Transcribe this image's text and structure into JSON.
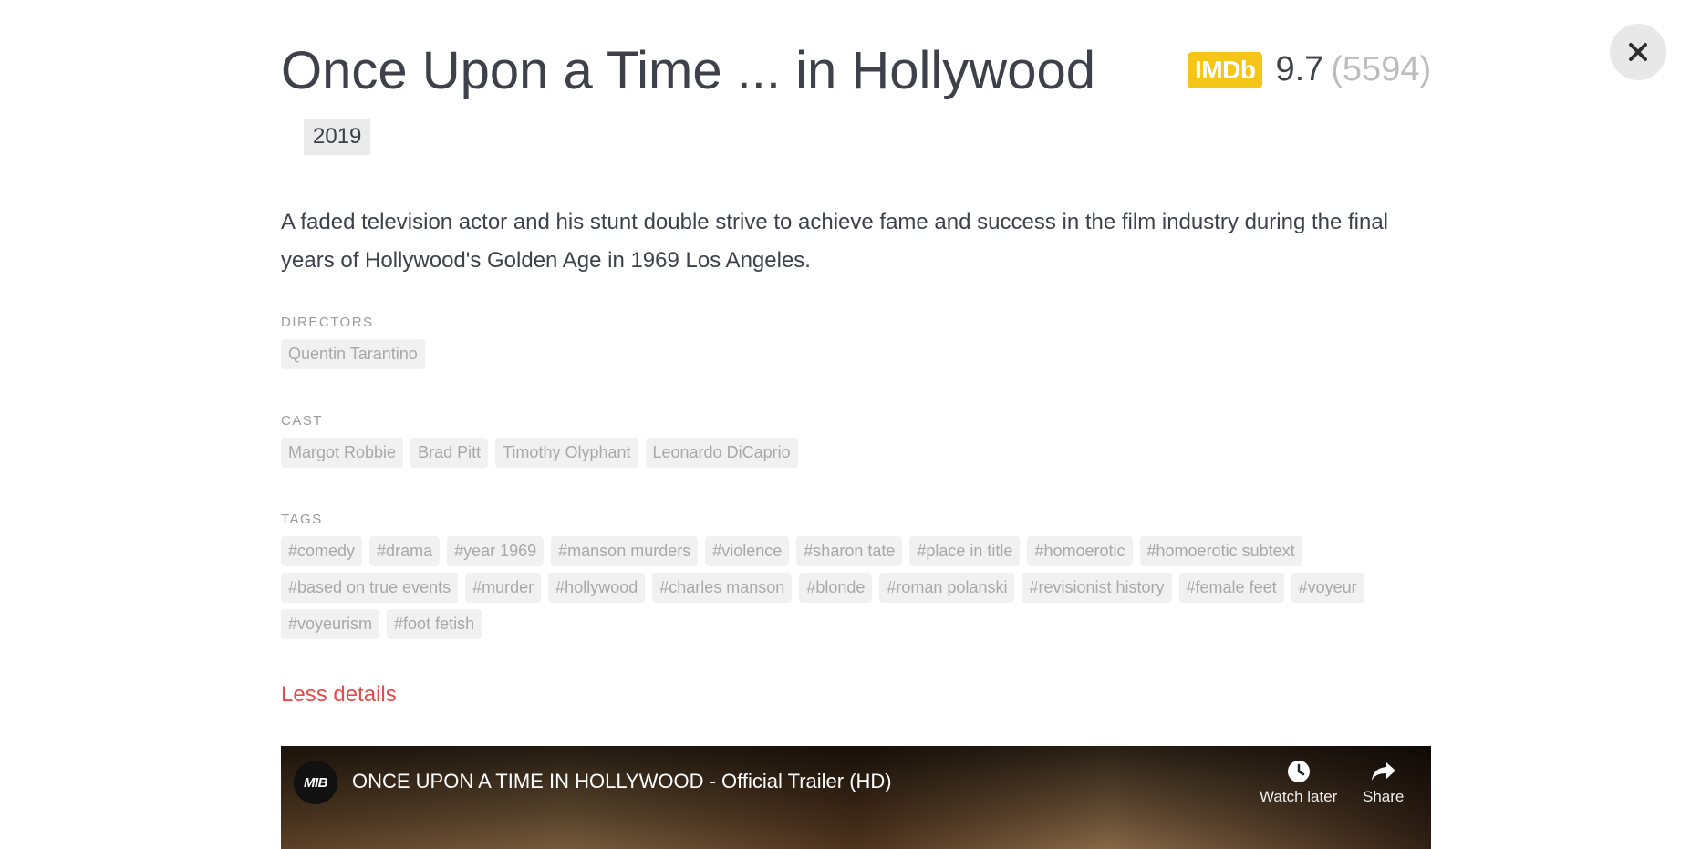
{
  "movie": {
    "title": "Once Upon a Time ... in Hollywood",
    "year": "2019",
    "description": "A faded television actor and his stunt double strive to achieve fame and success in the film industry during the final years of Hollywood's Golden Age in 1969 Los Angeles.",
    "rating": {
      "badge": "IMDb",
      "score": "9.7",
      "votes": "(5594)"
    }
  },
  "sections": {
    "directors": {
      "label": "DIRECTORS",
      "items": [
        "Quentin Tarantino"
      ]
    },
    "cast": {
      "label": "CAST",
      "items": [
        "Margot Robbie",
        "Brad Pitt",
        "Timothy Olyphant",
        "Leonardo DiCaprio"
      ]
    },
    "tags": {
      "label": "TAGS",
      "items": [
        "#comedy",
        "#drama",
        "#year 1969",
        "#manson murders",
        "#violence",
        "#sharon tate",
        "#place in title",
        "#homoerotic",
        "#homoerotic subtext",
        "#based on true events",
        "#murder",
        "#hollywood",
        "#charles manson",
        "#blonde",
        "#roman polanski",
        "#revisionist history",
        "#female feet",
        "#voyeur",
        "#voyeurism",
        "#foot fetish"
      ]
    }
  },
  "less_details": "Less details",
  "video": {
    "channel_badge": "MIB",
    "title": "ONCE UPON A TIME IN HOLLYWOOD - Official Trailer (HD)",
    "watch_later": "Watch later",
    "share": "Share"
  },
  "icons": {
    "close": "close-icon",
    "clock": "clock-icon",
    "share": "share-icon"
  },
  "colors": {
    "imdb": "#f5c518",
    "link": "#e64a4a",
    "chip_bg": "#f1f1f1",
    "chip_text": "#a8a8a8"
  }
}
